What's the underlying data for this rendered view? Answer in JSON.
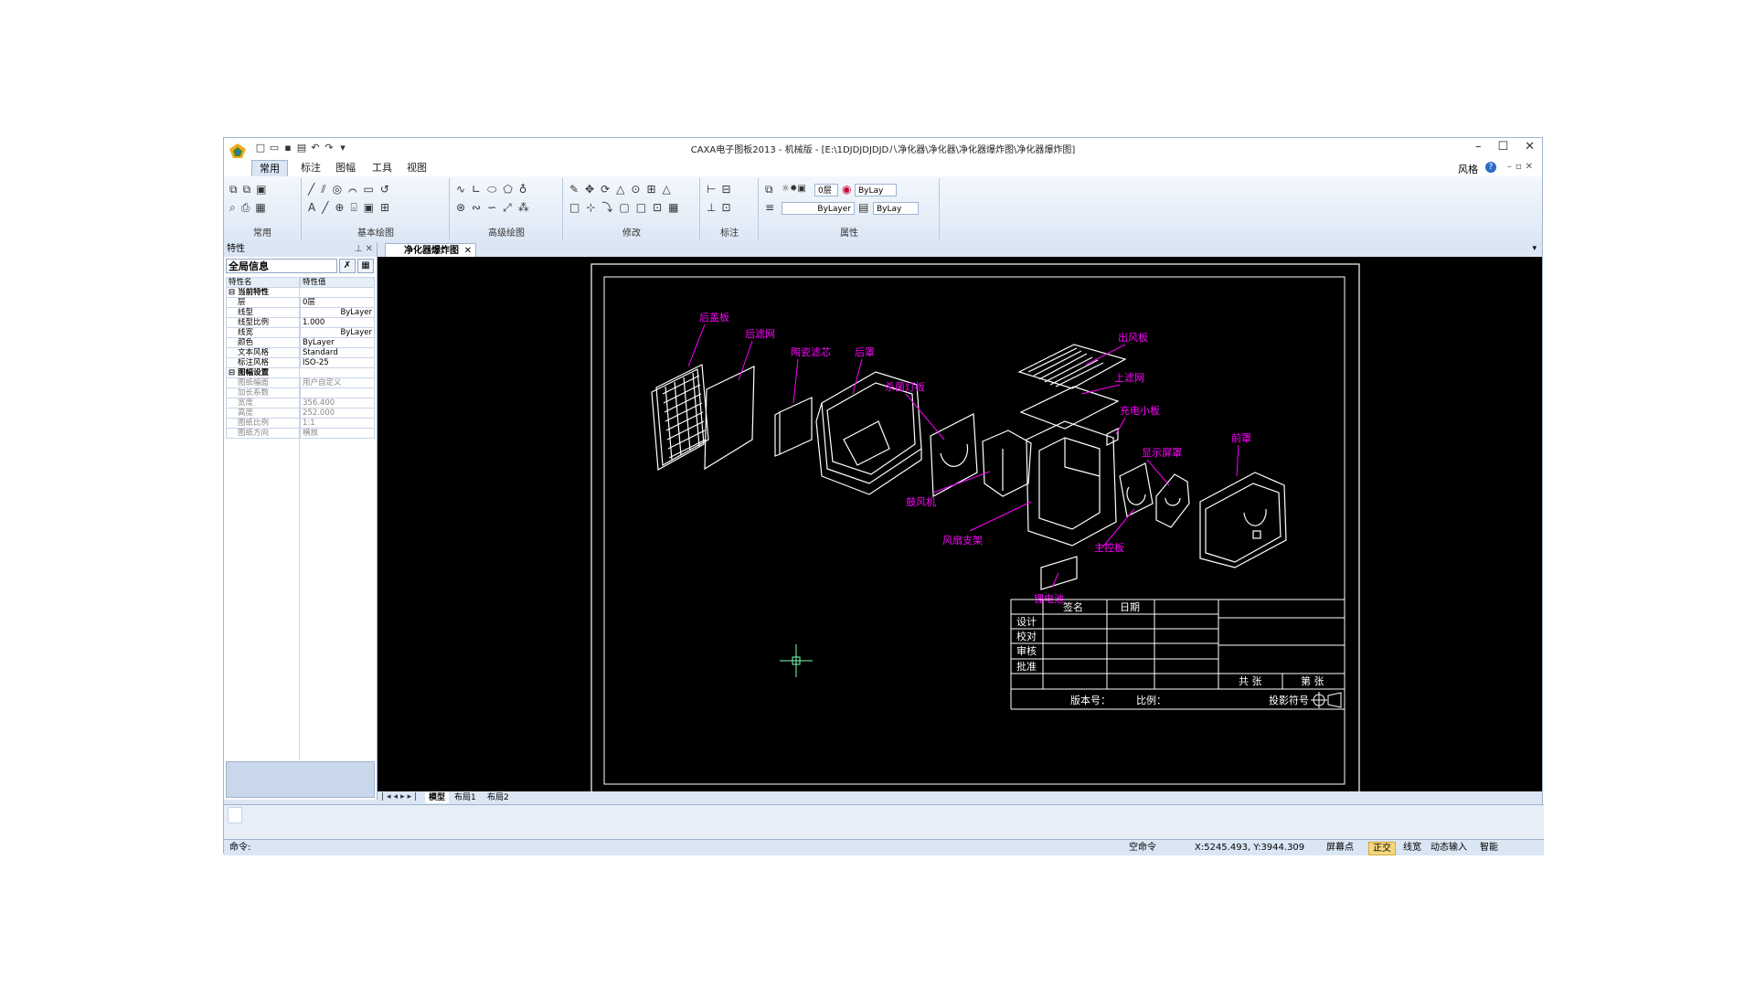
{
  "app": {
    "title": "CAXA电子图板2013 - 机械版 - [E:\\1DJDJDJDJD八净化器\\净化器\\净化器爆炸图\\净化器爆炸图]",
    "ribbon_tabs": [
      "常用",
      "标注",
      "图幅",
      "工具",
      "视图"
    ],
    "active_tab": "常用",
    "style_label": "风格",
    "window_controls": [
      "–",
      "☐",
      "✕"
    ]
  },
  "ribbon": {
    "groups": [
      "常用",
      "基本绘图",
      "高级绘图",
      "修改",
      "标注",
      "属性"
    ],
    "layer_combo": "0层",
    "color_combo": "ByLay",
    "linetype_combo": "ByLayer",
    "lineweight_combo": "ByLay"
  },
  "properties_panel": {
    "title": "特性",
    "scope": "全局信息",
    "col_name": "特性名",
    "col_value": "特性值",
    "sections": [
      {
        "name": "当前特性",
        "rows": [
          {
            "k": "层",
            "v": "0层"
          },
          {
            "k": "线型",
            "v": "ByLayer"
          },
          {
            "k": "线型比例",
            "v": "1.000"
          },
          {
            "k": "线宽",
            "v": "ByLayer"
          },
          {
            "k": "颜色",
            "v": "ByLayer"
          },
          {
            "k": "文本风格",
            "v": "Standard"
          },
          {
            "k": "标注风格",
            "v": "ISO-25"
          }
        ]
      },
      {
        "name": "图幅设置",
        "rows": [
          {
            "k": "图纸幅面",
            "v": "用户自定义"
          },
          {
            "k": "加长系数",
            "v": ""
          },
          {
            "k": "宽度",
            "v": "356.400"
          },
          {
            "k": "高度",
            "v": "252.000"
          },
          {
            "k": "图纸比例",
            "v": "1:1"
          },
          {
            "k": "图纸方向",
            "v": "横放"
          }
        ]
      }
    ]
  },
  "document_tab": "净化器爆炸图",
  "drawing": {
    "labels": [
      "后盖板",
      "后滤网",
      "陶瓷滤芯",
      "后罩",
      "杀菌灯板",
      "出风板",
      "上滤网",
      "充电小板",
      "显示屏罩",
      "前罩",
      "鼓风机",
      "风扇支架",
      "主控板",
      "锂电池"
    ],
    "title_block": {
      "headers": [
        "签名",
        "日期"
      ],
      "rows": [
        "设计",
        "校对",
        "审核",
        "批准"
      ],
      "total_sheets": "共 张",
      "sheet_no": "第 张",
      "version": "版本号：",
      "scale": "比例：",
      "projection": "投影符号"
    },
    "colors": {
      "background": "#000000",
      "label": "#ff00ff",
      "line": "#ffffff"
    }
  },
  "layout_tabs": [
    "模型",
    "布局1",
    "布局2"
  ],
  "status": {
    "command_label": "命令:",
    "state": "空命令",
    "coords": "X:5245.493, Y:3944.309",
    "snap": "屏幕点",
    "ortho": "正交",
    "lineweight": "线宽",
    "dyn_input": "动态输入",
    "smart": "智能"
  }
}
